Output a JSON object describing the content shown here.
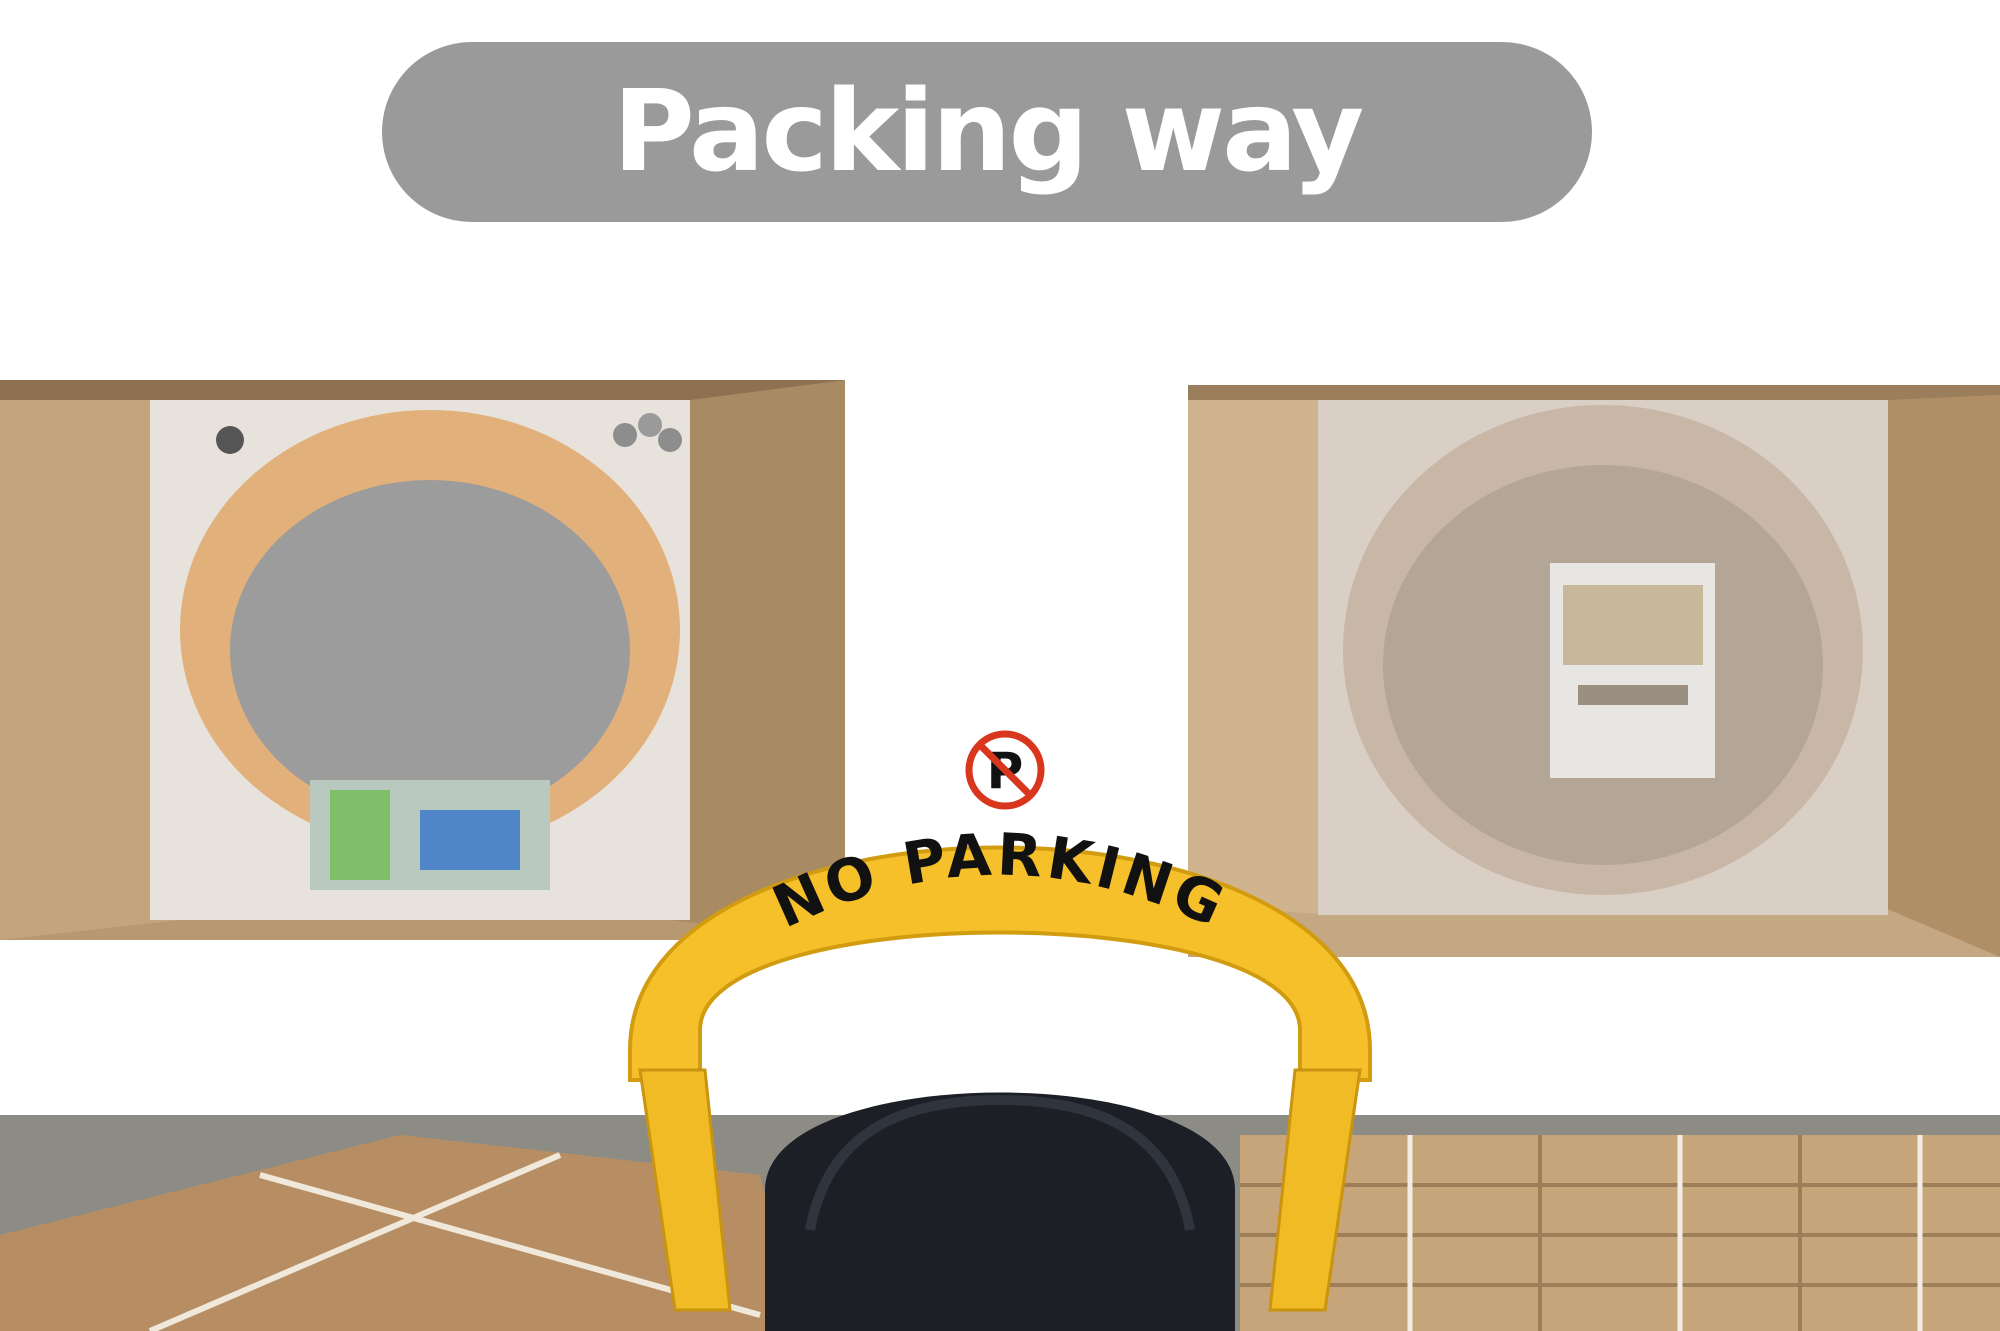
{
  "banner": {
    "title": "Packing way",
    "color": "#9a9a9a"
  },
  "product": {
    "sign_text": "NO PARKING",
    "sign_symbol": "P",
    "arm_color": "#f5c02a",
    "body_color": "#1c1f26"
  },
  "photos": [
    {
      "name": "boxed-lock-orange"
    },
    {
      "name": "boxed-lock-wrapped"
    },
    {
      "name": "stacked-cartons"
    }
  ]
}
